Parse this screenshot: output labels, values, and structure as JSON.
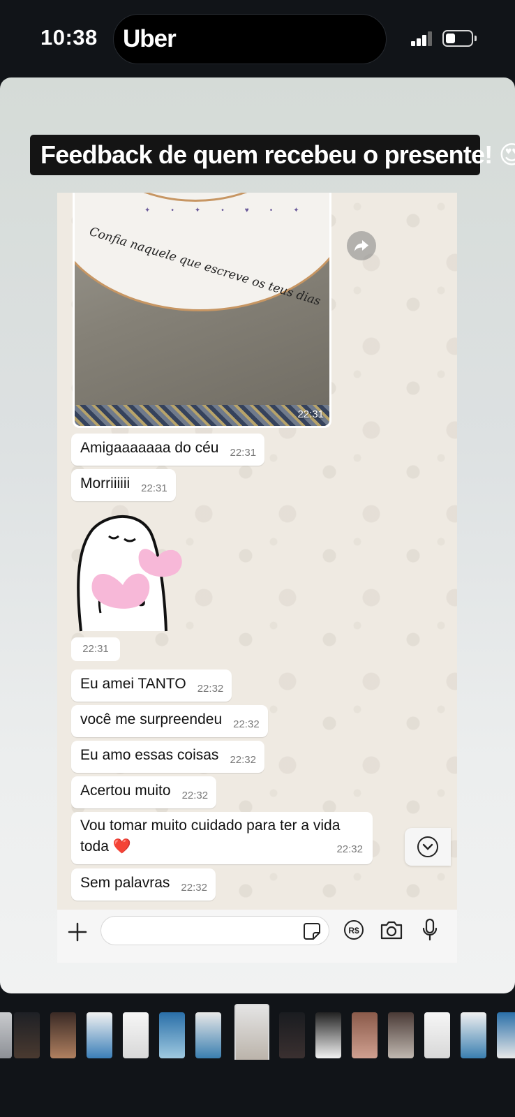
{
  "status_bar": {
    "time": "10:38",
    "island_app": "Uber",
    "signal_bars": 3,
    "battery_level": 0.3
  },
  "story": {
    "caption": "Feedback de quem recebeu o presente! 😍💕"
  },
  "chat": {
    "photo": {
      "plate_text": "Confia naquele que escreve os teus dias",
      "time": "22:31"
    },
    "messages": [
      {
        "text": "Amigaaaaaaa do céu",
        "time": "22:31"
      },
      {
        "text": "Morriiiiii",
        "time": "22:31"
      },
      {
        "text": "Eu amei TANTO",
        "time": "22:32"
      },
      {
        "text": "você me surpreendeu",
        "time": "22:32"
      },
      {
        "text": "Eu amo essas coisas",
        "time": "22:32"
      },
      {
        "text": "Acertou muito",
        "time": "22:32"
      },
      {
        "text": "Vou tomar muito cuidado para ter a vida toda ❤️",
        "time": "22:32"
      },
      {
        "text": "Sem palavras",
        "time": "22:32"
      }
    ],
    "sticker": {
      "time": "22:31"
    },
    "input_placeholder": ""
  },
  "colors": {
    "chat_background": "#efeae2",
    "bubble": "#ffffff",
    "heart": "#f7b8d8",
    "story_bg": "#dde1e2"
  },
  "icons": [
    "forward-icon",
    "chevron-down-icon",
    "plus-icon",
    "sticker-icon",
    "pix-real-icon",
    "camera-icon",
    "microphone-icon"
  ],
  "thumbnails": {
    "count": 14,
    "selected_index": 6
  }
}
